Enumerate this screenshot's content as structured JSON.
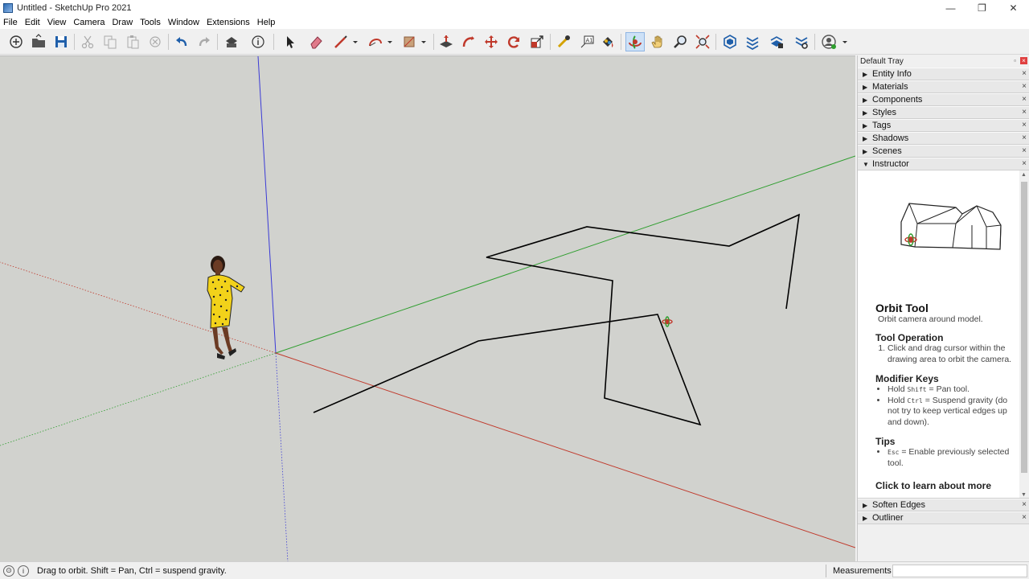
{
  "window": {
    "title": "Untitled - SketchUp Pro 2021",
    "minimize": "—",
    "maximize": "❐",
    "close": "✕"
  },
  "menu": [
    "File",
    "Edit",
    "View",
    "Camera",
    "Draw",
    "Tools",
    "Window",
    "Extensions",
    "Help"
  ],
  "colors": {
    "viewport_bg": "#d1d2ce",
    "axis_red": "#c0392b",
    "axis_green": "#2f9e2f",
    "axis_blue": "#3b3bd6",
    "active_tool": "#cde1f7"
  },
  "tray": {
    "title": "Default Tray",
    "pin": "▫",
    "close": "×",
    "panels": [
      {
        "label": "Entity Info",
        "expanded": false
      },
      {
        "label": "Materials",
        "expanded": false
      },
      {
        "label": "Components",
        "expanded": false
      },
      {
        "label": "Styles",
        "expanded": false
      },
      {
        "label": "Tags",
        "expanded": false
      },
      {
        "label": "Shadows",
        "expanded": false
      },
      {
        "label": "Scenes",
        "expanded": false
      },
      {
        "label": "Instructor",
        "expanded": true
      }
    ],
    "bottom_panels": [
      {
        "label": "Soften Edges",
        "expanded": false
      },
      {
        "label": "Outliner",
        "expanded": false
      }
    ],
    "collapsed_glyph": "▶",
    "expanded_glyph": "▼",
    "panel_close": "×"
  },
  "instructor": {
    "title": "Orbit Tool",
    "subtitle": "Orbit camera around model.",
    "operation_heading": "Tool Operation",
    "operation_step": "Click and drag cursor within the drawing area to orbit the camera.",
    "modifier_heading": "Modifier Keys",
    "modifier_1_pre": "Hold ",
    "modifier_1_key": "Shift",
    "modifier_1_post": " = Pan tool.",
    "modifier_2_pre": "Hold ",
    "modifier_2_key": "Ctrl",
    "modifier_2_post": " = Suspend gravity (do not try to keep vertical edges up and down).",
    "tips_heading": "Tips",
    "tip_key": "Esc",
    "tip_post": " = Enable previously selected tool.",
    "learn_more": "Click to learn about more"
  },
  "status": {
    "hint": "Drag to orbit. Shift = Pan, Ctrl = suspend gravity.",
    "info_glyph": "i",
    "geo_glyph": "⊙",
    "measurements_label": "Measurements",
    "measurements_value": ""
  },
  "toolbar": {
    "active_tool": "orbit-tool",
    "tools": [
      "new",
      "open",
      "save",
      "cut",
      "copy",
      "paste",
      "erase",
      "undo",
      "redo",
      "print",
      "model-info",
      "select",
      "eraser",
      "pencil-line",
      "arc",
      "rectangle",
      "push-pull",
      "follow-me",
      "move",
      "rotate",
      "scale",
      "tape-measure",
      "text",
      "paint-bucket",
      "orbit",
      "pan",
      "zoom",
      "zoom-extents",
      "warehouse",
      "extension-warehouse",
      "layout",
      "extension-manager",
      "account"
    ]
  }
}
